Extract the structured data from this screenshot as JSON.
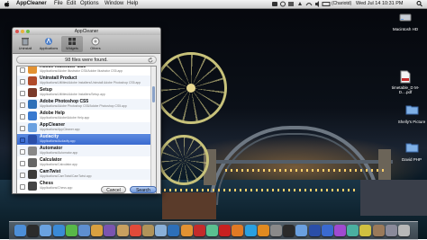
{
  "menubar": {
    "app_name": "AppCleaner",
    "menus": [
      "File",
      "Edit",
      "Options",
      "Window",
      "Help"
    ],
    "user": "(Chariotd)",
    "datetime": "Wed Jul 14  10:31 PM"
  },
  "desktop_icons": [
    {
      "label": "Macintosh HD"
    },
    {
      "label": "timetable_D M-D....pdf"
    },
    {
      "label": "Shelly's Picture"
    },
    {
      "label": "David PHP"
    }
  ],
  "window": {
    "title": "AppCleaner",
    "toolbar": [
      {
        "label": "Uninstall",
        "icon": "trash-icon"
      },
      {
        "label": "Applications",
        "icon": "applications-icon"
      },
      {
        "label": "Widgets",
        "icon": "widgets-icon"
      },
      {
        "label": "Others",
        "icon": "others-icon"
      }
    ],
    "status": "98 files were found.",
    "rows": [
      {
        "name": "Adobe Illustrator CS5",
        "path": "/Applications/Adobe Illustrator CS5/Adobe Illustrator CS5.app",
        "color": "#e39232",
        "checked": false
      },
      {
        "name": "Uninstall Product",
        "path": "/Applications/Utilities/Adobe Installers/Uninstall Adobe Photoshop CS5.app",
        "color": "#b04a2a",
        "checked": false
      },
      {
        "name": "Setup",
        "path": "/Applications/Utilities/Adobe Installers/Setup.app",
        "color": "#7a3a2a",
        "checked": false
      },
      {
        "name": "Adobe Photoshop CS5",
        "path": "/Applications/Adobe Photoshop CS5/Adobe Photoshop CS5.app",
        "color": "#2d6fb8",
        "checked": false
      },
      {
        "name": "Adobe Help",
        "path": "/Applications/Adobe/Adobe Help.app",
        "color": "#3a7ad0",
        "checked": false
      },
      {
        "name": "AppCleaner",
        "path": "/Applications/AppCleaner.app",
        "color": "#6aa0e0",
        "checked": false
      },
      {
        "name": "Audacity",
        "path": "/Applications/Audacity.app",
        "color": "#2a4ea8",
        "checked": true
      },
      {
        "name": "Automator",
        "path": "/Applications/Automator.app",
        "color": "#888888",
        "checked": false
      },
      {
        "name": "Calculator",
        "path": "/Applications/Calculator.app",
        "color": "#666666",
        "checked": false
      },
      {
        "name": "CamTwist",
        "path": "/Applications/CamTwist/CamTwist.app",
        "color": "#3a3a3a",
        "checked": false
      },
      {
        "name": "Chess",
        "path": "/Applications/Chess.app",
        "color": "#444444",
        "checked": false
      }
    ],
    "selected_index": 6,
    "cancel_label": "Cancel",
    "search_label": "Search"
  },
  "dock": {
    "items": [
      "finder-icon",
      "dashboard-icon",
      "mail-icon",
      "safari-icon",
      "ichat-icon",
      "itunes-icon",
      "iphoto-icon",
      "imovie-icon",
      "garageband-icon",
      "calendar-icon",
      "address-book-icon",
      "preview-icon",
      "photoshop-icon",
      "illustrator-icon",
      "flash-icon",
      "dreamweaver-icon",
      "acrobat-icon",
      "firefox-icon",
      "skype-icon",
      "vlc-icon",
      "system-preferences-icon",
      "terminal-icon",
      "appcleaner-icon",
      "audacity-icon",
      "itunes-store-icon",
      "app-icon",
      "app-icon-2",
      "app-icon-3",
      "downloads-stack-icon",
      "documents-stack-icon",
      "trash-icon"
    ],
    "colors": [
      "#4d8fd8",
      "#2b2b2b",
      "#6aa2e0",
      "#3a8ad6",
      "#58b848",
      "#5e8fd0",
      "#d8a040",
      "#7a55b0",
      "#c8a060",
      "#e04a3a",
      "#b0935a",
      "#8ab0d8",
      "#2d6fb8",
      "#e39232",
      "#c42b2b",
      "#5ac090",
      "#c82020",
      "#e07a24",
      "#2aa0e0",
      "#e08a20",
      "#8a8a8a",
      "#2a2a2a",
      "#6aa0e0",
      "#2a4ea8",
      "#3a6ad0",
      "#a04ad0",
      "#4ab0a0",
      "#d0c040",
      "#9a7a5a",
      "#8a8a9a",
      "#b8b8b8"
    ]
  }
}
